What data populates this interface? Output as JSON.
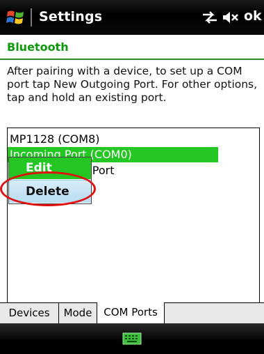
{
  "titlebar": {
    "title": "Settings",
    "ok_label": "ok",
    "icons": [
      "windows-start-icon",
      "connectivity-icon",
      "volume-muted-icon"
    ]
  },
  "header": {
    "title": "Bluetooth"
  },
  "instructions": "After pairing with a device, to set up a COM port tap New Outgoing Port. For other options, tap and hold an existing port.",
  "ports": [
    {
      "label": "MP1128 (COM8)"
    },
    {
      "label": "Incoming Port (COM0)",
      "selected": true
    },
    {
      "label": "New Outgoing Port"
    }
  ],
  "context_menu": {
    "items": [
      {
        "label": "Edit",
        "highlighted": true
      },
      {
        "label": "Delete",
        "hovered": true
      }
    ]
  },
  "tabs": [
    {
      "label": "Devices"
    },
    {
      "label": "Mode"
    },
    {
      "label": "COM Ports",
      "active": true
    }
  ],
  "softkeys": {
    "icons": [
      "keyboard-icon"
    ]
  },
  "colors": {
    "accent_green": "#23c623",
    "header_green": "#0b9a0b",
    "annotation_red": "#e01010"
  }
}
